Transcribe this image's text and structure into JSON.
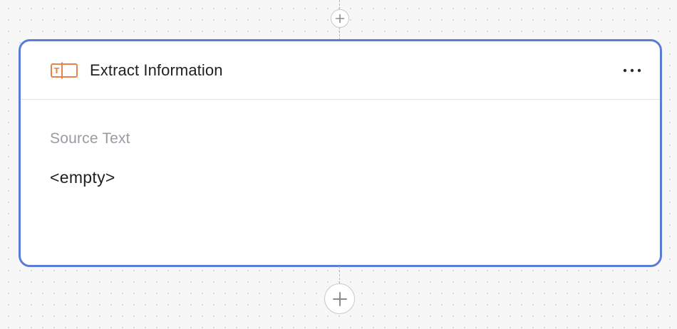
{
  "canvas": {
    "background_color": "#f7f7f8",
    "dot_color": "#d9d9de"
  },
  "top_add": {
    "icon": "plus-icon"
  },
  "bottom_add": {
    "icon": "plus-icon"
  },
  "node": {
    "icon": "extract-text-icon",
    "accent_color": "#e8834a",
    "border_color": "#5b7cd6",
    "title": "Extract Information",
    "menu_icon": "more-horizontal-icon",
    "fields": [
      {
        "label": "Source Text",
        "value": "<empty>"
      }
    ]
  }
}
